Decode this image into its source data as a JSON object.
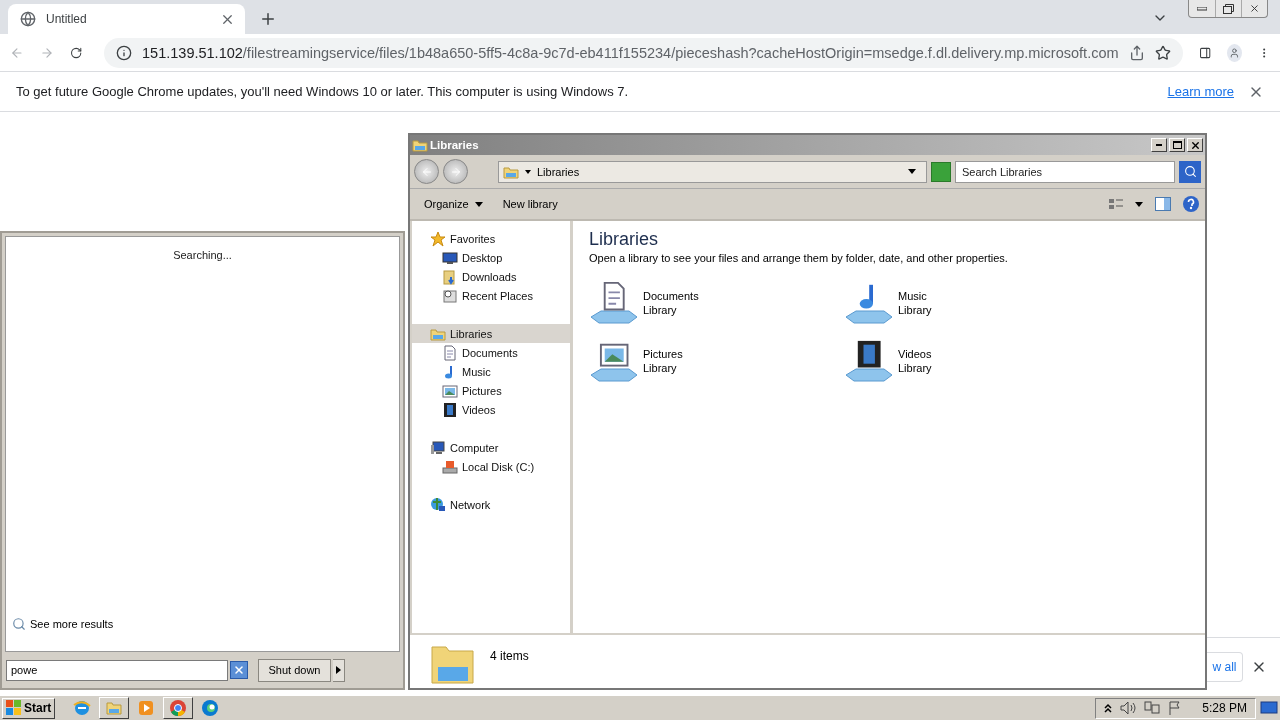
{
  "browser": {
    "tab": {
      "title": "Untitled",
      "selected": true
    },
    "url": {
      "host": "151.139.51.102",
      "path": "/filestreamingservice/files/1b48a650-5ff5-4c8a-9c7d-eb411f155234/pieceshash?cacheHostOrigin=msedge.f.dl.delivery.mp.microsoft.com"
    },
    "infobar": {
      "message": "To get future Google Chrome updates, you'll need Windows 10 or later. This computer is using Windows 7.",
      "link": "Learn more"
    }
  },
  "start_menu": {
    "status": "Searching...",
    "more_results": "See more results",
    "search": {
      "value": "powe"
    },
    "shutdown": "Shut down"
  },
  "explorer": {
    "title": "Libraries",
    "breadcrumb": "Libraries",
    "search": {
      "placeholder": "Search Libraries"
    },
    "toolbar": [
      {
        "label": "Organize",
        "dropdown": true
      },
      {
        "label": "New library",
        "dropdown": false
      }
    ],
    "nav": [
      {
        "label": "Favorites",
        "kind": "star",
        "selected": false,
        "children": [
          {
            "label": "Desktop",
            "kind": "desktop",
            "selected": false
          },
          {
            "label": "Downloads",
            "kind": "downloads",
            "selected": false
          },
          {
            "label": "Recent Places",
            "kind": "recent",
            "selected": false
          }
        ]
      },
      {
        "label": "Libraries",
        "kind": "library",
        "selected": true,
        "children": [
          {
            "label": "Documents",
            "kind": "documents",
            "selected": false
          },
          {
            "label": "Music",
            "kind": "music",
            "selected": false
          },
          {
            "label": "Pictures",
            "kind": "pictures",
            "selected": false
          },
          {
            "label": "Videos",
            "kind": "videos",
            "selected": false
          }
        ]
      },
      {
        "label": "Computer",
        "kind": "computer",
        "selected": false,
        "children": [
          {
            "label": "Local Disk (C:)",
            "kind": "disk",
            "selected": false
          }
        ]
      },
      {
        "label": "Network",
        "kind": "network",
        "selected": false
      }
    ],
    "heading": "Libraries",
    "description": "Open a library to see your files and arrange them by folder, date, and other properties.",
    "libraries": [
      {
        "name": "Documents",
        "type": "Library",
        "kind": "documents"
      },
      {
        "name": "Music",
        "type": "Library",
        "kind": "music"
      },
      {
        "name": "Pictures",
        "type": "Library",
        "kind": "pictures"
      },
      {
        "name": "Videos",
        "type": "Library",
        "kind": "videos"
      }
    ],
    "status": "4 items"
  },
  "download_bar": {
    "button": "w all"
  },
  "taskbar": {
    "start": "Start",
    "apps": [
      {
        "kind": "ie",
        "open": false
      },
      {
        "kind": "explorer",
        "open": true
      },
      {
        "kind": "media",
        "open": false
      },
      {
        "kind": "chrome",
        "open": true
      },
      {
        "kind": "edge",
        "open": false
      }
    ],
    "clock": "5:28 PM"
  }
}
